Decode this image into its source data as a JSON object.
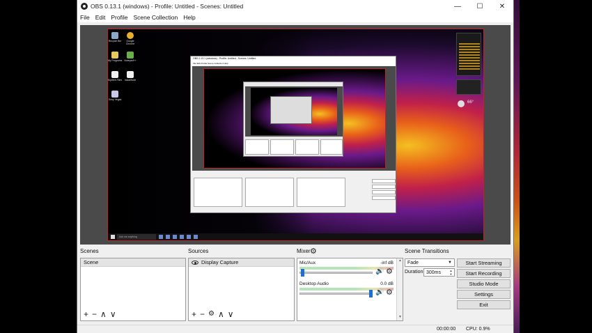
{
  "window": {
    "title": "OBS 0.13.1 (windows) - Profile: Untitled - Scenes: Untitled",
    "controls": {
      "minimize": "—",
      "maximize": "☐",
      "close": "✕"
    }
  },
  "menu": [
    "File",
    "Edit",
    "Profile",
    "Scene Collection",
    "Help"
  ],
  "preview": {
    "desktop_icons": [
      {
        "label": "Recycle Bin",
        "color": "#8aa8c8"
      },
      {
        "label": "Google Chrome",
        "color": "#e8b030"
      },
      {
        "label": "My Programs",
        "color": "#e8c860"
      },
      {
        "label": "Notepad++",
        "color": "#6ab04a"
      },
      {
        "label": "MyWeb Files",
        "color": "#f0f0f0"
      },
      {
        "label": "InstallNote",
        "color": "#f0f0f0"
      },
      {
        "label": "Sony Vegas",
        "color": "#c8c8e8"
      }
    ],
    "taskbar_search": "Ask me anything",
    "widget_weather": "66°",
    "nested_title": "OBS 0.13.1 (windows) - Profile: Untitled - Scenes: Untitled",
    "nested_menu": "File  Edit  Profile  Scene Collection  Help"
  },
  "scenes": {
    "label": "Scenes",
    "items": [
      "Scene"
    ],
    "toolbar": {
      "add": "+",
      "remove": "−",
      "up": "∧",
      "down": "∨"
    }
  },
  "sources": {
    "label": "Sources",
    "items": [
      "Display Capture"
    ],
    "toolbar": {
      "add": "+",
      "remove": "−",
      "settings": "⚙",
      "up": "∧",
      "down": "∨"
    }
  },
  "mixer": {
    "label": "Mixer",
    "channels": [
      {
        "name": "Mic/Aux",
        "db": "-inf dB",
        "volume_fraction": 0.02
      },
      {
        "name": "Desktop Audio",
        "db": "0.0 dB",
        "volume_fraction": 1.0
      }
    ]
  },
  "transitions": {
    "label": "Scene Transitions",
    "selected": "Fade",
    "duration_label": "Duration",
    "duration_value": "300ms"
  },
  "controls": {
    "start_streaming": "Start Streaming",
    "start_recording": "Start Recording",
    "studio_mode": "Studio Mode",
    "settings": "Settings",
    "exit": "Exit"
  },
  "status": {
    "time": "00:00:00",
    "cpu": "CPU: 0.9%"
  }
}
